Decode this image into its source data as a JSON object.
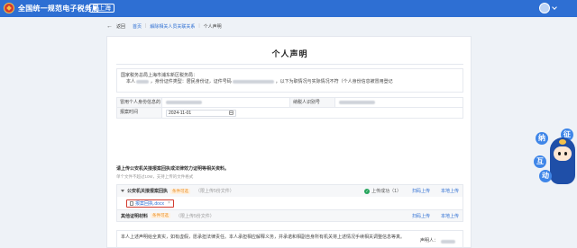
{
  "header": {
    "site_title": "全国统一规范电子税务局",
    "region": "上海"
  },
  "nav": {
    "back_label": "返回",
    "breadcrumb": [
      "首页",
      "解除相关人员关联关系",
      "个人声明"
    ]
  },
  "document": {
    "title": "个人声明",
    "declaration_line1": "国家税务总局上海市浦东新区税务局：",
    "declaration_line2_prefix": "本人",
    "declaration_line2_mid": "，身份证件类型：居民身份证，证件号码",
    "declaration_line2_suffix": "，以下为职情况与实际情况不符（个人身份信息被冒用登记",
    "table": {
      "row1": {
        "label1": "冒用个人身份信息的单位名称",
        "label2": "纳税人识别号"
      },
      "row2": {
        "label1": "报案时间",
        "date_value": "2024-11-01"
      }
    }
  },
  "upload": {
    "note": "请上传公安机关接报案回执或法律效力证明等相关资料。",
    "sub_note": "单个文件不超过10M，支持上传的文件格式",
    "section1": {
      "title": "公安机关接报案回执",
      "tag": "条件可选",
      "limit": "（限上传5份文件）",
      "status": "上传成功（1）",
      "action1": "扫码上传",
      "action2": "本地上传",
      "file_name": "报案回执.docx",
      "file_close": "×"
    },
    "section2": {
      "title": "其他证明材料",
      "tag": "条件可选",
      "limit": "（限上传5份文件）",
      "action1": "扫码上传",
      "action2": "本地上传"
    }
  },
  "statement": {
    "text": "本人上述声明给全真实，如有虚假，愿承担法律责任。本人承担相应解释义务，并承诺和相副自身所有机关将上述情况手续相关调整信息等真。",
    "signer_label": "声明人："
  },
  "mascot": {
    "chars": [
      "纳",
      "征",
      "互",
      "动"
    ]
  },
  "colors": {
    "brand_blue": "#2e6fd3",
    "tag_orange": "#e98a1a",
    "success_green": "#27a55d",
    "highlight_red": "#d23a2e"
  }
}
